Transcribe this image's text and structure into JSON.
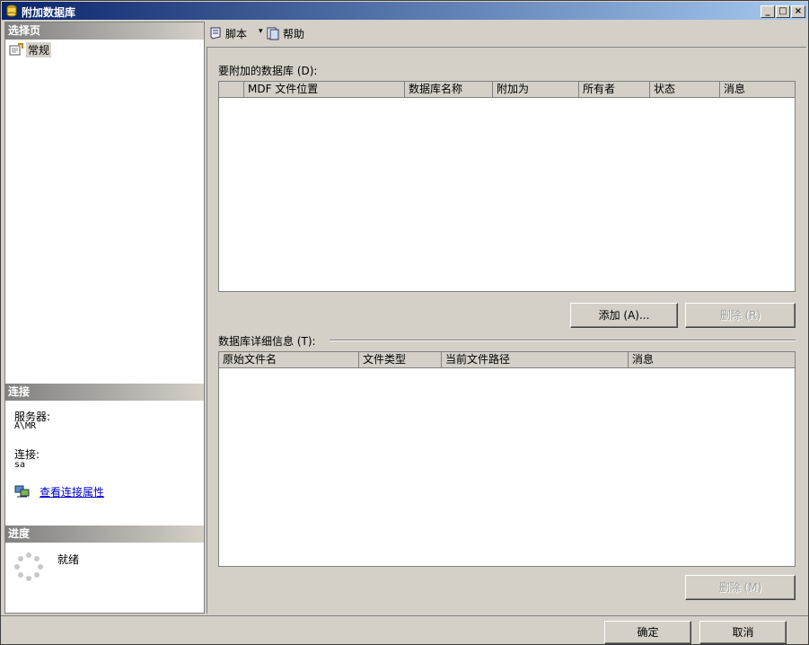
{
  "window": {
    "title": "附加数据库"
  },
  "left": {
    "select_page_header": "选择页",
    "nav_items": [
      {
        "label": "常规",
        "icon": "page-settings-icon"
      }
    ],
    "connection_header": "连接",
    "server_label": "服务器:",
    "server_value": "A\\MR",
    "connection_label": "连接:",
    "connection_value": "sa",
    "view_link": "查看连接属性",
    "progress_header": "进度",
    "progress_status": "就绪"
  },
  "toolbar": {
    "script_label": "脚本",
    "dropdown_glyph": "▾",
    "help_label": "帮助"
  },
  "attach": {
    "group_label": "要附加的数据库 (D):",
    "columns": [
      "",
      "MDF 文件位置",
      "数据库名称",
      "附加为",
      "所有者",
      "状态",
      "消息"
    ],
    "add_button": "添加 (A)...",
    "remove_button": "删除 (R)"
  },
  "details": {
    "group_label": "数据库详细信息 (T):",
    "columns": [
      "原始文件名",
      "文件类型",
      "当前文件路径",
      "消息"
    ],
    "remove_button": "删除 (M)"
  },
  "footer": {
    "ok_button": "确定",
    "cancel_button": "取消"
  },
  "colors": {
    "title_start": "#0a246a",
    "title_end": "#a6caf0",
    "link": "#0000cc",
    "face": "#d4d0c8"
  }
}
